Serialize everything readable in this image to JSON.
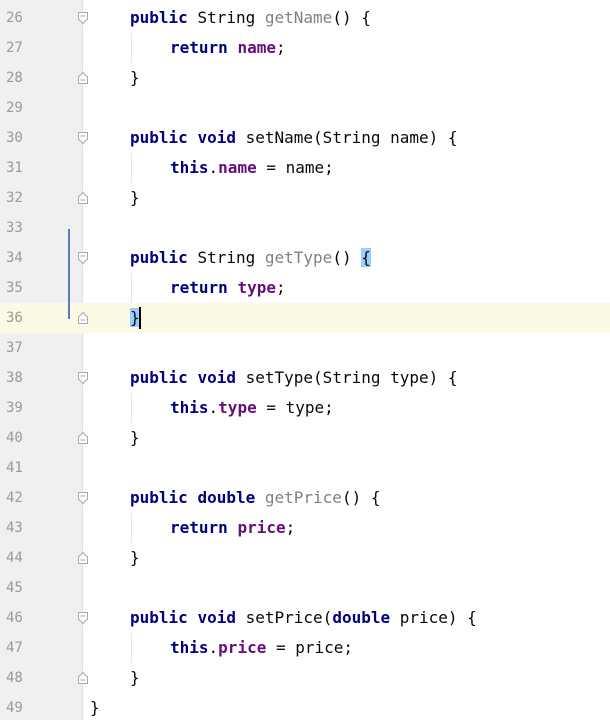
{
  "editor": {
    "lines": [
      {
        "n": "26",
        "fold": "start",
        "indent": 1,
        "tokens": [
          {
            "t": "public",
            "c": "kw"
          },
          {
            "t": " "
          },
          {
            "t": "String",
            "c": ""
          },
          {
            "t": " "
          },
          {
            "t": "getName",
            "c": "unused"
          },
          {
            "t": "() {"
          }
        ]
      },
      {
        "n": "27",
        "fold": "",
        "indent": 2,
        "tokens": [
          {
            "t": "return",
            "c": "kw"
          },
          {
            "t": " "
          },
          {
            "t": "name",
            "c": "fld"
          },
          {
            "t": ";"
          }
        ]
      },
      {
        "n": "28",
        "fold": "end",
        "indent": 1,
        "tokens": [
          {
            "t": "}"
          }
        ]
      },
      {
        "n": "29",
        "fold": "",
        "indent": 0,
        "tokens": []
      },
      {
        "n": "30",
        "fold": "start",
        "indent": 1,
        "tokens": [
          {
            "t": "public",
            "c": "kw"
          },
          {
            "t": " "
          },
          {
            "t": "void",
            "c": "kw"
          },
          {
            "t": " "
          },
          {
            "t": "setName",
            "c": ""
          },
          {
            "t": "(String name) {"
          }
        ]
      },
      {
        "n": "31",
        "fold": "",
        "indent": 2,
        "tokens": [
          {
            "t": "this",
            "c": "kw"
          },
          {
            "t": "."
          },
          {
            "t": "name",
            "c": "fld"
          },
          {
            "t": " = name;"
          }
        ]
      },
      {
        "n": "32",
        "fold": "end",
        "indent": 1,
        "tokens": [
          {
            "t": "}"
          }
        ]
      },
      {
        "n": "33",
        "fold": "",
        "indent": 0,
        "tokens": []
      },
      {
        "n": "34",
        "fold": "start",
        "indent": 1,
        "tokens": [
          {
            "t": "public",
            "c": "kw"
          },
          {
            "t": " "
          },
          {
            "t": "String",
            "c": ""
          },
          {
            "t": " "
          },
          {
            "t": "getType",
            "c": "unused"
          },
          {
            "t": "() "
          },
          {
            "t": "{",
            "c": "brace-hl"
          }
        ]
      },
      {
        "n": "35",
        "fold": "",
        "indent": 2,
        "tokens": [
          {
            "t": "return",
            "c": "kw"
          },
          {
            "t": " "
          },
          {
            "t": "type",
            "c": "fld"
          },
          {
            "t": ";"
          }
        ]
      },
      {
        "n": "36",
        "fold": "end",
        "indent": 1,
        "current": true,
        "tokens": [
          {
            "t": "}",
            "c": "brace-hl"
          }
        ]
      },
      {
        "n": "37",
        "fold": "",
        "indent": 0,
        "tokens": []
      },
      {
        "n": "38",
        "fold": "start",
        "indent": 1,
        "tokens": [
          {
            "t": "public",
            "c": "kw"
          },
          {
            "t": " "
          },
          {
            "t": "void",
            "c": "kw"
          },
          {
            "t": " "
          },
          {
            "t": "setType",
            "c": ""
          },
          {
            "t": "(String type) {"
          }
        ]
      },
      {
        "n": "39",
        "fold": "",
        "indent": 2,
        "tokens": [
          {
            "t": "this",
            "c": "kw"
          },
          {
            "t": "."
          },
          {
            "t": "type",
            "c": "fld"
          },
          {
            "t": " = type;"
          }
        ]
      },
      {
        "n": "40",
        "fold": "end",
        "indent": 1,
        "tokens": [
          {
            "t": "}"
          }
        ]
      },
      {
        "n": "41",
        "fold": "",
        "indent": 0,
        "tokens": []
      },
      {
        "n": "42",
        "fold": "start",
        "indent": 1,
        "tokens": [
          {
            "t": "public",
            "c": "kw"
          },
          {
            "t": " "
          },
          {
            "t": "double",
            "c": "kw"
          },
          {
            "t": " "
          },
          {
            "t": "getPrice",
            "c": "unused"
          },
          {
            "t": "() {"
          }
        ]
      },
      {
        "n": "43",
        "fold": "",
        "indent": 2,
        "tokens": [
          {
            "t": "return",
            "c": "kw"
          },
          {
            "t": " "
          },
          {
            "t": "price",
            "c": "fld"
          },
          {
            "t": ";"
          }
        ]
      },
      {
        "n": "44",
        "fold": "end",
        "indent": 1,
        "tokens": [
          {
            "t": "}"
          }
        ]
      },
      {
        "n": "45",
        "fold": "",
        "indent": 0,
        "tokens": []
      },
      {
        "n": "46",
        "fold": "start",
        "indent": 1,
        "tokens": [
          {
            "t": "public",
            "c": "kw"
          },
          {
            "t": " "
          },
          {
            "t": "void",
            "c": "kw"
          },
          {
            "t": " "
          },
          {
            "t": "setPrice",
            "c": ""
          },
          {
            "t": "("
          },
          {
            "t": "double",
            "c": "kw"
          },
          {
            "t": " price) {"
          }
        ]
      },
      {
        "n": "47",
        "fold": "",
        "indent": 2,
        "tokens": [
          {
            "t": "this",
            "c": "kw"
          },
          {
            "t": "."
          },
          {
            "t": "price",
            "c": "fld"
          },
          {
            "t": " = price;"
          }
        ]
      },
      {
        "n": "48",
        "fold": "end",
        "indent": 1,
        "tokens": [
          {
            "t": "}"
          }
        ]
      },
      {
        "n": "49",
        "fold": "",
        "indent": 0,
        "tokens": [
          {
            "t": "}"
          }
        ]
      }
    ]
  },
  "colors": {
    "keyword": "#000080",
    "field": "#660e7a",
    "unused_method": "#808080",
    "brace_match": "#99ccff",
    "current_line": "#fcfae5",
    "gutter": "#f0f0f0",
    "line_number": "#999999"
  }
}
